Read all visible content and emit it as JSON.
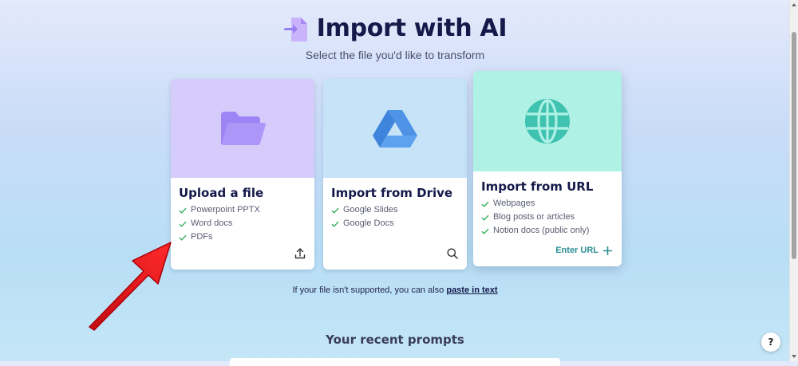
{
  "header": {
    "title": "Import with AI",
    "subtitle": "Select the file you'd like to transform"
  },
  "cards": [
    {
      "id": "upload",
      "title": "Upload a file",
      "items": [
        "Powerpoint PPTX",
        "Word docs",
        "PDFs"
      ],
      "banner_color": "#d6ccfb",
      "icon": "folder-icon",
      "action_icon": "upload-icon"
    },
    {
      "id": "drive",
      "title": "Import from Drive",
      "items": [
        "Google Slides",
        "Google Docs"
      ],
      "banner_color": "#c6e3f8",
      "icon": "google-drive-icon",
      "action_icon": "search-icon"
    },
    {
      "id": "url",
      "title": "Import from URL",
      "items": [
        "Webpages",
        "Blog posts or articles",
        "Notion docs (public only)"
      ],
      "banner_color": "#b0f1e6",
      "icon": "globe-icon",
      "action_label": "Enter URL"
    }
  ],
  "footer": {
    "unsupported_text": "If your file isn't supported, you can also ",
    "paste_link": "paste in text"
  },
  "recent": {
    "title": "Your recent prompts"
  },
  "help": {
    "label": "?"
  },
  "colors": {
    "accent_teal": "#2b8f95",
    "check_green": "#2fae5a",
    "title_navy": "#14194a",
    "annotation_red": "#e8141a"
  }
}
